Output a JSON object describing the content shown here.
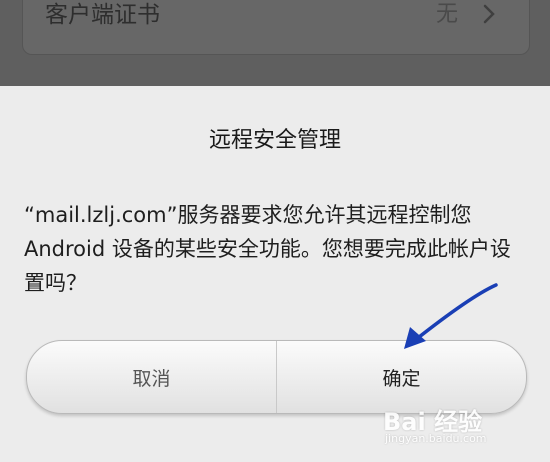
{
  "background_screen": {
    "row_label": "客户端证书",
    "row_value": "无",
    "row_icon": "chevron-right-icon"
  },
  "dialog": {
    "title": "远程安全管理",
    "message": "“mail.lzlj.com”服务器要求您允许其远程控制您 Android 设备的某些安全功能。您想要完成此帐户设置吗？",
    "cancel_label": "取消",
    "ok_label": "确定"
  },
  "annotation": {
    "icon": "blue-arrow-icon",
    "color": "#1a3fb5"
  },
  "watermark": {
    "brand": "Bai 经验",
    "url": "jingyan.baidu.com"
  }
}
